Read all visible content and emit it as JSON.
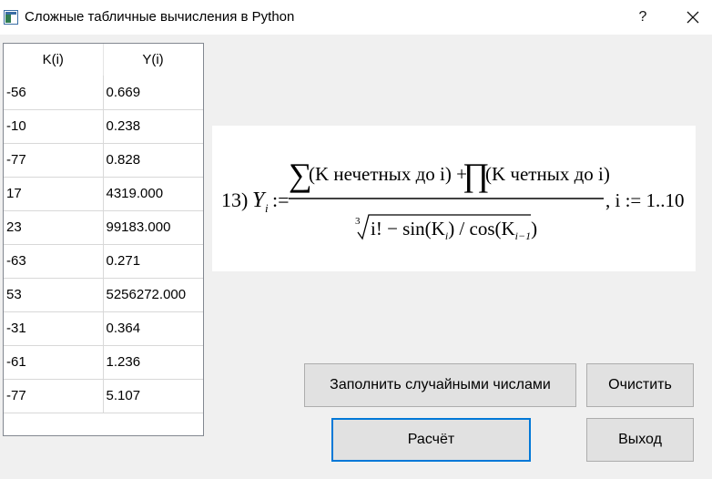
{
  "window": {
    "title": "Сложные табличные вычисления в Python",
    "help_label": "?",
    "close_icon": "close-icon",
    "app_icon": "app-window-icon"
  },
  "table": {
    "headers": [
      "K(i)",
      "Y(i)"
    ],
    "rows": [
      [
        "-56",
        "0.669"
      ],
      [
        "-10",
        "0.238"
      ],
      [
        "-77",
        "0.828"
      ],
      [
        "17",
        "4319.000"
      ],
      [
        "23",
        "99183.000"
      ],
      [
        "-63",
        "0.271"
      ],
      [
        "53",
        "5256272.000"
      ],
      [
        "-31",
        "0.364"
      ],
      [
        "-61",
        "1.236"
      ],
      [
        "-77",
        "5.107"
      ]
    ]
  },
  "formula": {
    "number": "13)",
    "Y": "Y",
    "sub_i": "i",
    "assign": ":=",
    "numerator_part1": "(K нечетных до i) +",
    "numerator_part2": "(K четных до i)",
    "root_index": "3",
    "denominator": "i! − sin(K",
    "den_sub1": "i",
    "den_mid": ") / cos(K",
    "den_sub2": "i−1",
    "den_end": ")",
    "range": ", i := 1..10"
  },
  "buttons": {
    "fill_random": "Заполнить случайными числами",
    "clear": "Очистить",
    "calculate": "Расчёт",
    "exit": "Выход"
  },
  "colors": {
    "window_bg": "#f0f0f0",
    "button_bg": "#e1e1e1",
    "focus_border": "#0078d7"
  }
}
